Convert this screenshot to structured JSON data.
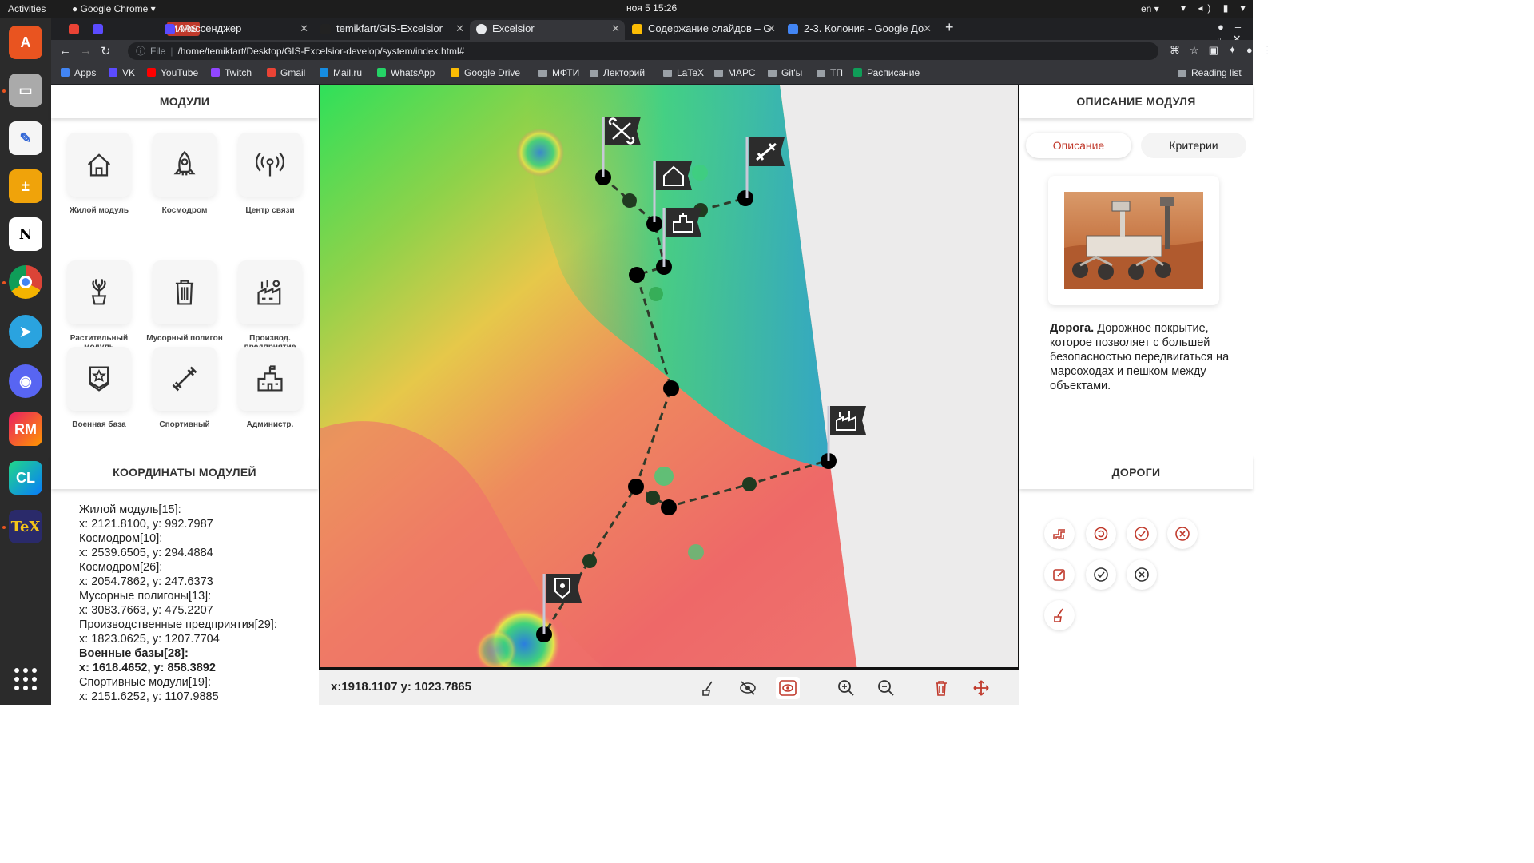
{
  "system": {
    "activities": "Activities",
    "app_menu": "Google Chrome",
    "clock": "ноя 5  15:26",
    "lang": "en"
  },
  "tabs": [
    {
      "label": "MARS",
      "pinned": true
    },
    {
      "label": "Мессенджер"
    },
    {
      "label": "temikfart/GIS-Excelsior"
    },
    {
      "label": "Excelsior",
      "active": true
    },
    {
      "label": "Содержание слайдов – G"
    },
    {
      "label": "2-3. Колония - Google До"
    }
  ],
  "address": {
    "scheme": "File",
    "url": "/home/temikfart/Desktop/GIS-Excelsior-develop/system/index.html#"
  },
  "bookmarks": [
    {
      "label": "Apps",
      "color": "#4285f4"
    },
    {
      "label": "VK",
      "color": "#5b4bff"
    },
    {
      "label": "YouTube",
      "color": "#ff0000"
    },
    {
      "label": "Twitch",
      "color": "#9146ff"
    },
    {
      "label": "Gmail",
      "color": "#ea4335"
    },
    {
      "label": "Mail.ru",
      "color": "#168de2"
    },
    {
      "label": "WhatsApp",
      "color": "#25d366"
    },
    {
      "label": "Google Drive",
      "color": "#fbbc04"
    },
    {
      "label": "МФТИ",
      "folder": true
    },
    {
      "label": "Лекторий",
      "folder": true
    },
    {
      "label": "LaTeX",
      "folder": true
    },
    {
      "label": "МАРС",
      "folder": true
    },
    {
      "label": "Git'ы",
      "folder": true
    },
    {
      "label": "ТП",
      "folder": true
    },
    {
      "label": "Расписание",
      "color": "#0f9d58"
    }
  ],
  "reading_list": "Reading list",
  "modules_panel": {
    "title": "МОДУЛИ",
    "items": [
      {
        "label": "Жилой модуль",
        "icon": "house-icon"
      },
      {
        "label": "Космодром",
        "icon": "rocket-icon"
      },
      {
        "label": "Центр связи",
        "icon": "antenna-icon"
      },
      {
        "label": "Растительный модуль",
        "icon": "plant-icon"
      },
      {
        "label": "Мусорный полигон",
        "icon": "trash-icon"
      },
      {
        "label": "Производ. предприятие",
        "icon": "factory-icon"
      },
      {
        "label": "Военная база",
        "icon": "military-badge-icon"
      },
      {
        "label": "Спортивный",
        "icon": "dumbbell-icon"
      },
      {
        "label": "Администр.",
        "icon": "admin-building-icon"
      }
    ]
  },
  "coords_panel": {
    "title": "КООРДИНАТЫ МОДУЛЕЙ",
    "lines": [
      {
        "text": "Жилой модуль[15]:"
      },
      {
        "text": "x: 2121.8100, y: 992.7987"
      },
      {
        "text": "Космодром[10]:"
      },
      {
        "text": "x: 2539.6505, y: 294.4884"
      },
      {
        "text": "Космодром[26]:"
      },
      {
        "text": "x: 2054.7862, y: 247.6373"
      },
      {
        "text": "Мусорные полигоны[13]:"
      },
      {
        "text": "x: 3083.7663, y: 475.2207"
      },
      {
        "text": "Производственные предприятия[29]:"
      },
      {
        "text": "x: 1823.0625, y: 1207.7704"
      },
      {
        "text": "Военные базы[28]:",
        "bold": true
      },
      {
        "text": "x: 1618.4652, y: 858.3892",
        "bold": true
      },
      {
        "text": "Спортивные модули[19]:"
      },
      {
        "text": "x: 2151.6252, y: 1107.9885"
      }
    ]
  },
  "map": {
    "cursor": "x:1918.1107 y: 1023.7865"
  },
  "right_panel": {
    "title": "ОПИСАНИЕ МОДУЛЯ",
    "tab_description": "Описание",
    "tab_criteria": "Критерии",
    "desc_bold": "Дорога.",
    "desc_text": " Дорожное покрытие, которое позволяет с большей безопасностью передвигаться на марсоходах и пешком между объектами."
  },
  "roads_panel": {
    "title": "ДОРОГИ"
  },
  "colors": {
    "accent": "#c0392b"
  }
}
